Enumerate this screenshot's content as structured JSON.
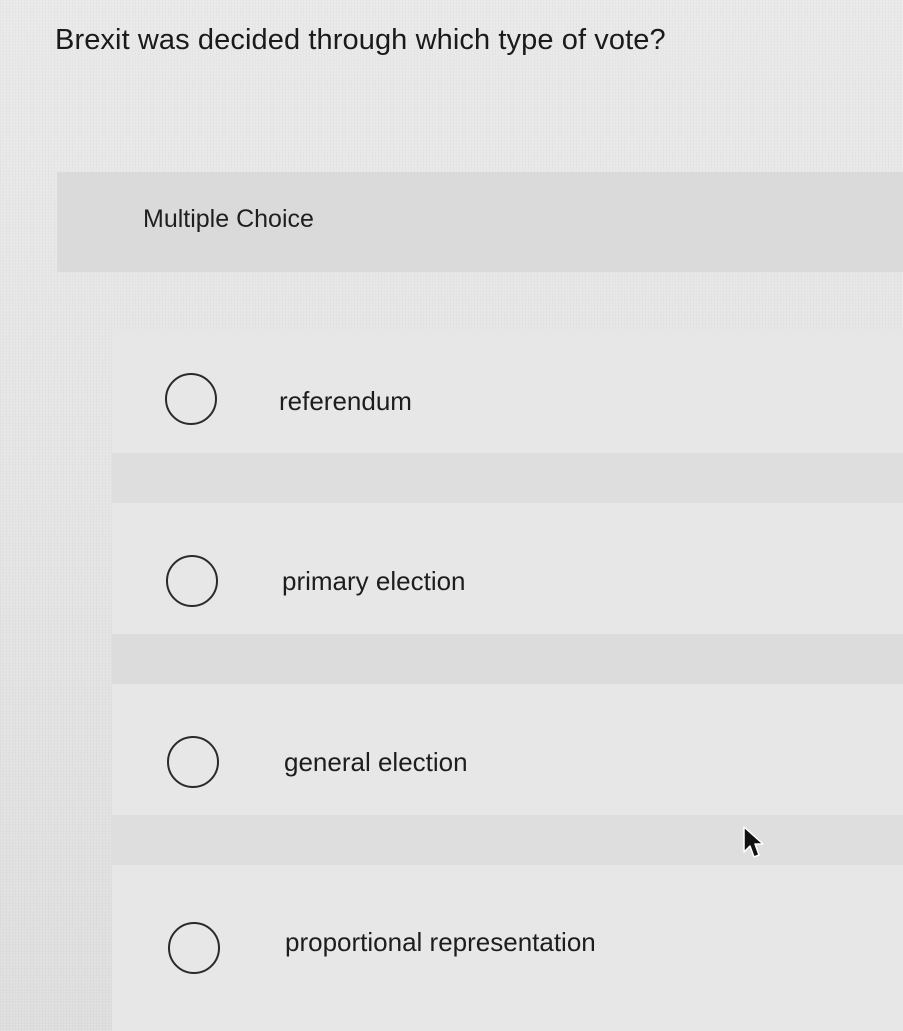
{
  "question": {
    "text": "Brexit was decided through which type of vote?"
  },
  "section": {
    "label": "Multiple Choice"
  },
  "options": [
    {
      "label": "referendum",
      "selected": false
    },
    {
      "label": "primary election",
      "selected": false
    },
    {
      "label": "general election",
      "selected": false
    },
    {
      "label": "proportional representation",
      "selected": false
    }
  ],
  "icons": {
    "radio": "radio-unselected-icon",
    "pointer": "mouse-pointer-icon"
  },
  "colors": {
    "background": "#e6e6e6",
    "panel": "#dadada",
    "text": "#1c1c1c"
  }
}
